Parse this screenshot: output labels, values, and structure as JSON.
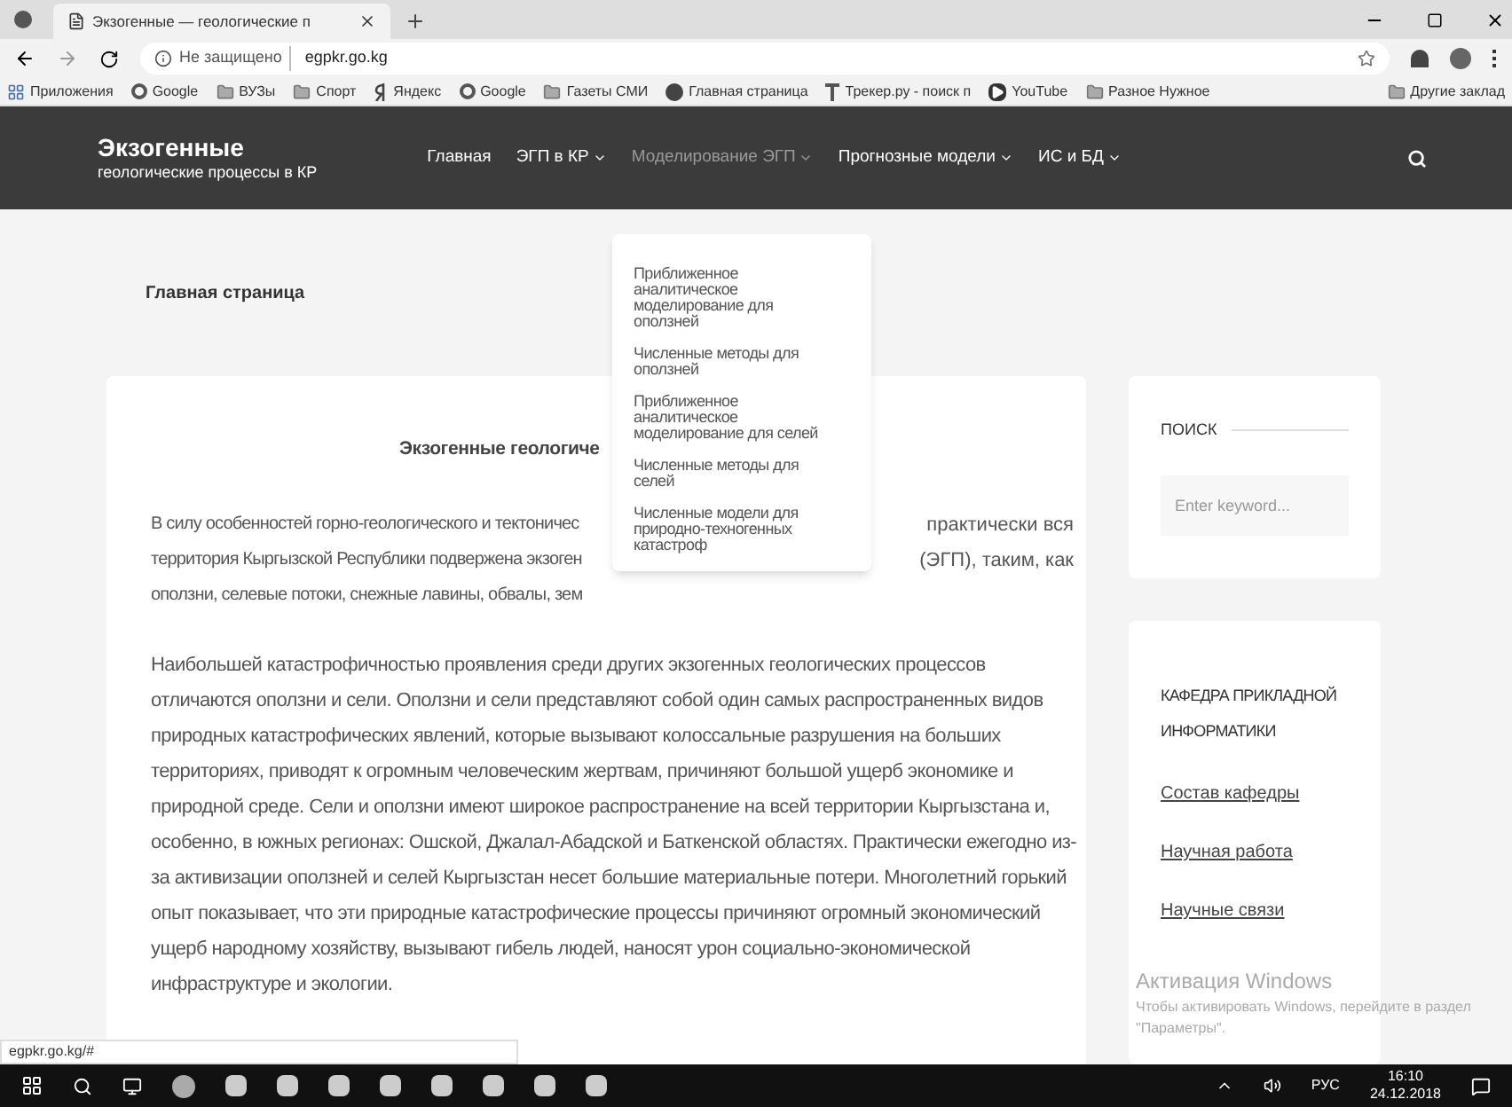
{
  "browser": {
    "tab_title": "Экзогенные — геологические п",
    "security": "Не защищено",
    "url": "egpkr.go.kg",
    "bookmarks": [
      {
        "kind": "apps",
        "label": "Приложения"
      },
      {
        "kind": "google",
        "label": "Google"
      },
      {
        "kind": "folder",
        "label": "ВУЗы"
      },
      {
        "kind": "folder",
        "label": "Спорт"
      },
      {
        "kind": "yandex",
        "label": "Яндекс"
      },
      {
        "kind": "google",
        "label": "Google"
      },
      {
        "kind": "folder",
        "label": "Газеты СМИ"
      },
      {
        "kind": "site",
        "label": "Главная страница"
      },
      {
        "kind": "tracker",
        "label": "Трекер.ру - поиск п"
      },
      {
        "kind": "youtube",
        "label": "YouTube"
      },
      {
        "kind": "folder",
        "label": "Разное Нужное"
      }
    ],
    "other_bookmarks": "Другие заклад"
  },
  "site": {
    "logo_title": "Экзогенные",
    "logo_subtitle": "геологические процессы в КР",
    "nav": [
      {
        "label": "Главная",
        "dropdown": false,
        "selected": false
      },
      {
        "label": "ЭГП в КР",
        "dropdown": true,
        "selected": false
      },
      {
        "label": "Моделирование ЭГП",
        "dropdown": true,
        "selected": true
      },
      {
        "label": "Прогнозные модели",
        "dropdown": true,
        "selected": false
      },
      {
        "label": "ИС и БД",
        "dropdown": true,
        "selected": false
      }
    ],
    "dropdown_menu": [
      "Приближенное аналитическое моделирование для оползней",
      "Численные методы для оползней",
      "Приближенное аналитическое моделирование для селей",
      "Численные методы для селей",
      "Численные модели для природно-техногенных катастроф"
    ],
    "breadcrumb": "Главная страница",
    "article": {
      "heading": "Экзогенные геологиче",
      "paragraph_1_lines": [
        {
          "left": "В силу особенностей горно-геологического и тектоничес",
          "right": "практически вся"
        },
        {
          "left": "территория Кыргызской Республики подвержена экзоген",
          "right": "(ЭГП), таким, как"
        },
        {
          "left": "оползни, селевые потоки, снежные лавины, обвалы, зем"
        }
      ],
      "paragraph_2": "Наибольшей катастрофичностью проявления среди других экзогенных геологических процессов отличаются оползни и сели. Оползни и сели представляют собой один самых распространенных видов природных катастрофических явлений, которые вызывают колоссальные разрушения на больших территориях, приводят к огромным человеческим жертвам, причиняют большой ущерб экономике и природной среде. Сели и оползни имеют широкое распространение на всей территории Кыргызстана и, особенно, в южных регионах: Ошской, Джалал-Абадской и Баткенской областях. Практически ежегодно из-за активизации оползней и селей Кыргызстан несет большие материальные потери. Многолетний горький опыт показывает, что эти природные катастрофические процессы причиняют огромный экономический ущерб народному хозяйству, вызывают гибель людей, наносят урон социально-экономической инфраструктуре и экологии."
    },
    "search_widget": {
      "title": "ПОИСК",
      "placeholder": "Enter keyword..."
    },
    "department": {
      "title": "КАФЕДРА ПРИКЛАДНОЙ ИНФОРМАТИКИ",
      "links": [
        "Состав кафедры",
        "Научная работа",
        "Научные связи"
      ]
    }
  },
  "status_url": "egpkr.go.kg/#",
  "activation": {
    "title": "Активация Windows",
    "text": "Чтобы активировать Windows, перейдите в раздел \"Параметры\"."
  },
  "taskbar": {
    "language": "РУС",
    "time": "16:10",
    "date": "24.12.2018"
  }
}
